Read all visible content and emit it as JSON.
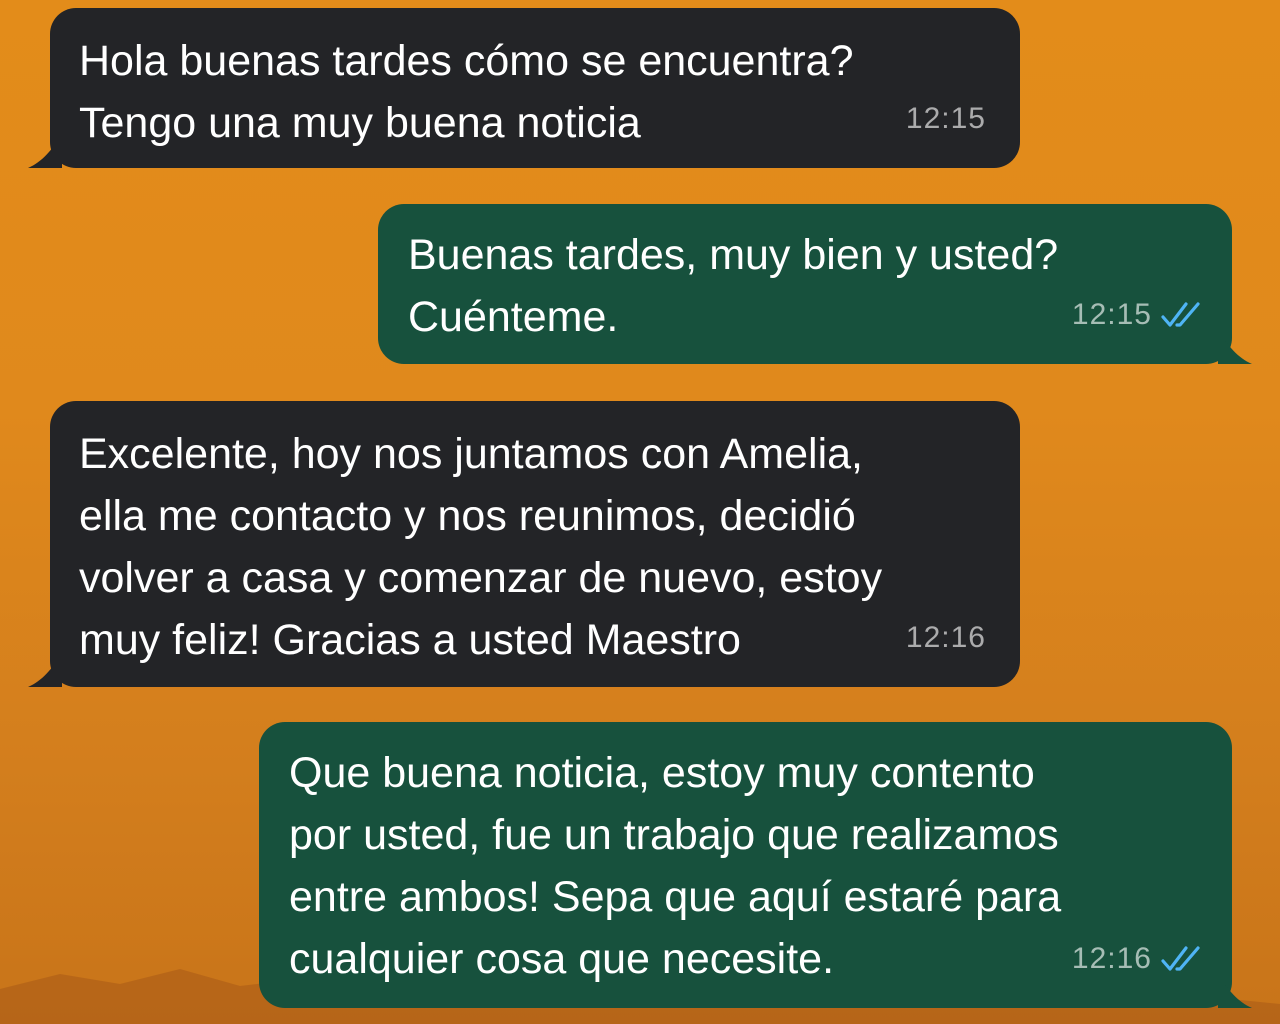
{
  "colors": {
    "incoming_bubble": "#232427",
    "outgoing_bubble": "#17513d",
    "wallpaper": "#e38c1a",
    "read_receipt": "#4fb4f5"
  },
  "messages": [
    {
      "direction": "incoming",
      "text": "Hola buenas tardes cómo se encuentra?\nTengo una muy buena noticia",
      "time": "12:15"
    },
    {
      "direction": "outgoing",
      "text": "Buenas tardes, muy bien y usted?\nCuénteme.",
      "time": "12:15",
      "status_icon": "double-check-icon"
    },
    {
      "direction": "incoming",
      "text": "Excelente, hoy nos juntamos con Amelia,\nella me contacto y nos reunimos, decidió\nvolver a casa y comenzar de nuevo, estoy\nmuy feliz! Gracias a usted Maestro",
      "time": "12:16"
    },
    {
      "direction": "outgoing",
      "text": "Que buena noticia, estoy muy contento\npor usted, fue un trabajo que realizamos\nentre ambos! Sepa que aquí estaré para\ncualquier cosa que necesite.",
      "time": "12:16",
      "status_icon": "double-check-icon"
    }
  ]
}
